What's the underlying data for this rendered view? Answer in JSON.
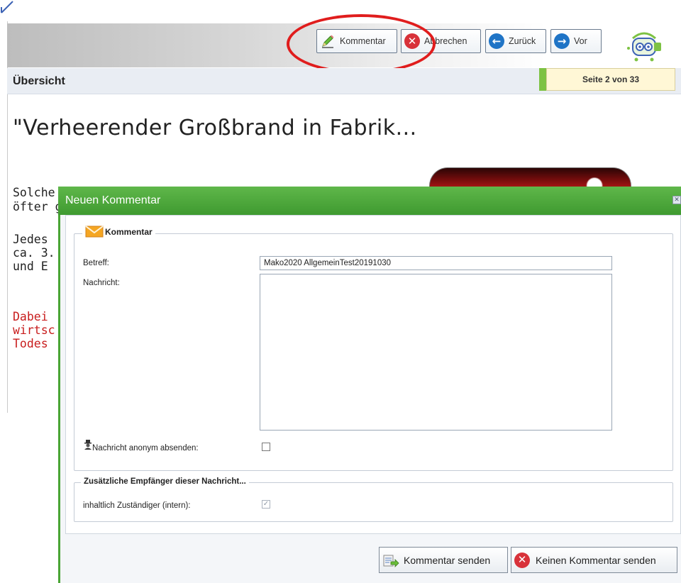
{
  "toolbar": {
    "comment_label": "Kommentar",
    "cancel_label": "Abbrechen",
    "back_label": "Zurück",
    "forward_label": "Vor"
  },
  "overview": {
    "title": "Übersicht",
    "page_indicator": "Seite 2 von 33"
  },
  "content": {
    "headline": "\"Verheerender Großbrand in Fabrik...",
    "fragments": [
      "Solche",
      "öfter g",
      "Jedes",
      "ca. 3.",
      "und E",
      "Dabei",
      "wirtsc",
      "Todes"
    ]
  },
  "dialog": {
    "title": "Neuen Kommentar",
    "close_symbol": "✕",
    "comment_legend": "Kommentar",
    "subject_label": "Betreff:",
    "subject_value": "Mako2020 AllgemeinTest20191030",
    "message_label": "Nachricht:",
    "message_value": "",
    "anonymous_label": "Nachricht anonym absenden:",
    "anonymous_checked": false,
    "recipients_legend": "Zusätzliche Empfänger dieser Nachricht...",
    "responsible_label": "inhaltlich Zuständiger (intern):",
    "responsible_checked": true,
    "send_label": "Kommentar senden",
    "no_comment_label": "Keinen Kommentar senden"
  },
  "colors": {
    "dialog_header": "#4aa535",
    "highlight": "#e01d1d",
    "content_red_text": "#c81d1d",
    "page_marker": "#7dc243"
  },
  "icons": {
    "comment": "pencil-icon",
    "cancel": "red-x-circle-icon",
    "back": "blue-left-arrow-icon",
    "forward": "blue-right-arrow-icon",
    "legend": "envelope-icon",
    "anonymous": "anonymous-user-icon",
    "send": "send-comment-icon"
  }
}
